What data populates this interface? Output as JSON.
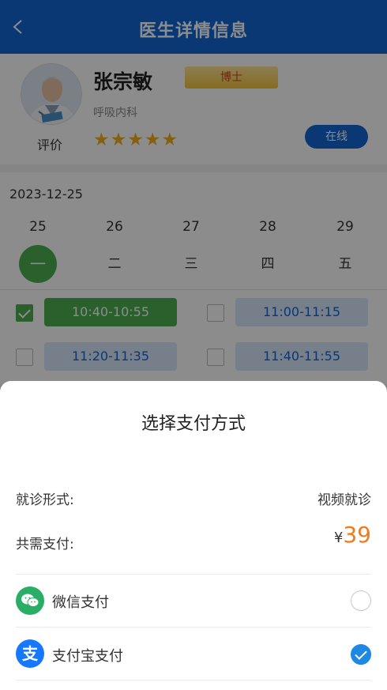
{
  "header": {
    "title": "医生详情信息",
    "back_icon": "chevron-left-icon"
  },
  "doctor": {
    "name": "张宗敏",
    "badge": "博士",
    "department": "呼吸内科",
    "rating_label": "评价",
    "stars": 5,
    "status": "在线"
  },
  "schedule": {
    "date": "2023-12-25",
    "days": [
      {
        "num": "25",
        "weekday": "一",
        "active": true
      },
      {
        "num": "26",
        "weekday": "二",
        "active": false
      },
      {
        "num": "27",
        "weekday": "三",
        "active": false
      },
      {
        "num": "28",
        "weekday": "四",
        "active": false
      },
      {
        "num": "29",
        "weekday": "五",
        "active": false
      }
    ]
  },
  "slots": [
    {
      "time": "10:40-10:55",
      "checked": true
    },
    {
      "time": "11:00-11:15",
      "checked": false
    },
    {
      "time": "11:20-11:35",
      "checked": false
    },
    {
      "time": "11:40-11:55",
      "checked": false
    }
  ],
  "payment_sheet": {
    "title": "选择支付方式",
    "visit_type_label": "就诊形式:",
    "visit_type_value": "视频就诊",
    "total_label": "共需支付:",
    "currency": "¥",
    "amount": "39",
    "methods": [
      {
        "label": "微信支付",
        "icon": "wechat-icon",
        "selected": false
      },
      {
        "label": "支付宝支付",
        "icon": "alipay-icon",
        "selected": true
      }
    ],
    "alipay_glyph": "支"
  },
  "colors": {
    "brand_blue": "#1266d6",
    "selected_green": "#4caf50",
    "price_orange": "#f07a1e",
    "star_gold": "#f2b01e"
  }
}
